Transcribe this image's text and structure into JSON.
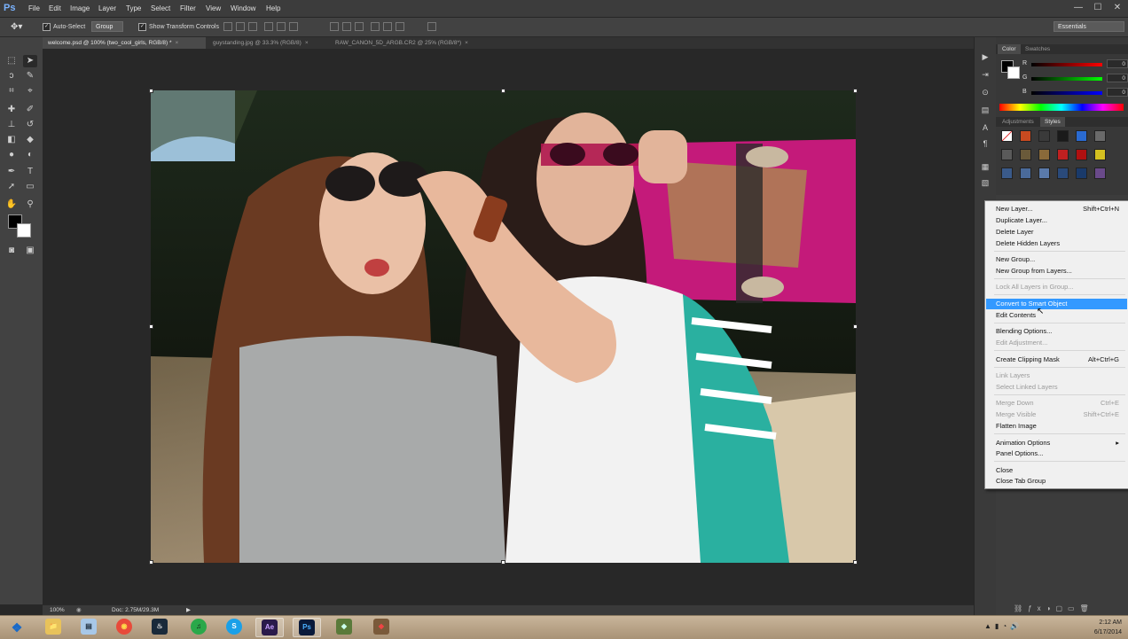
{
  "app": {
    "logo": "Ps"
  },
  "menubar": {
    "items": [
      "File",
      "Edit",
      "Image",
      "Layer",
      "Type",
      "Select",
      "Filter",
      "View",
      "Window",
      "Help"
    ],
    "win_min": "—",
    "win_max": "☐",
    "win_close": "✕"
  },
  "options": {
    "auto_select_label": "Auto-Select",
    "auto_select_value": "Group",
    "show_transform_label": "Show Transform Controls",
    "workspace": "Essentials"
  },
  "doc_tabs": [
    {
      "label": "welcome.psd @ 100% (two_cool_girls, RGB/8) *"
    },
    {
      "label": "guystanding.jpg @ 33.3% (RGB/8)"
    },
    {
      "label": "RAW_CANON_5D_ARGB.CR2 @ 25% (RGB/8*)"
    }
  ],
  "status": {
    "zoom": "100%",
    "doc": "Doc: 2.75M/29.3M"
  },
  "panels": {
    "color_tabs": [
      "Color",
      "Swatches"
    ],
    "sliders": [
      {
        "label": "R",
        "value": "0",
        "track_color": "linear-gradient(90deg,#000,#f00)"
      },
      {
        "label": "G",
        "value": "0",
        "track_color": "linear-gradient(90deg,#000,#0f0)"
      },
      {
        "label": "B",
        "value": "0",
        "track_color": "linear-gradient(90deg,#000,#00f)"
      }
    ],
    "style_tabs": [
      "Adjustments",
      "Styles"
    ]
  },
  "context_menu": {
    "items": [
      {
        "label": "New Layer...",
        "shortcut": "Shift+Ctrl+N",
        "state": "normal"
      },
      {
        "label": "Duplicate Layer...",
        "shortcut": "",
        "state": "normal"
      },
      {
        "label": "Delete Layer",
        "shortcut": "",
        "state": "normal"
      },
      {
        "label": "Delete Hidden Layers",
        "shortcut": "",
        "state": "normal"
      },
      {
        "label": "New Group...",
        "shortcut": "",
        "state": "normal"
      },
      {
        "label": "New Group from Layers...",
        "shortcut": "",
        "state": "normal"
      },
      {
        "label": "Lock All Layers in Group...",
        "shortcut": "",
        "state": "disabled"
      },
      {
        "label": "Convert to Smart Object",
        "shortcut": "",
        "state": "highlighted"
      },
      {
        "label": "Edit Contents",
        "shortcut": "",
        "state": "normal"
      },
      {
        "label": "Blending Options...",
        "shortcut": "",
        "state": "normal"
      },
      {
        "label": "Edit Adjustment...",
        "shortcut": "",
        "state": "disabled"
      },
      {
        "label": "Create Clipping Mask",
        "shortcut": "Alt+Ctrl+G",
        "state": "normal"
      },
      {
        "label": "Link Layers",
        "shortcut": "",
        "state": "disabled"
      },
      {
        "label": "Select Linked Layers",
        "shortcut": "",
        "state": "disabled"
      },
      {
        "label": "Merge Down",
        "shortcut": "Ctrl+E",
        "state": "disabled"
      },
      {
        "label": "Merge Visible",
        "shortcut": "Shift+Ctrl+E",
        "state": "disabled"
      },
      {
        "label": "Flatten Image",
        "shortcut": "",
        "state": "normal"
      },
      {
        "label": "Animation Options",
        "shortcut": "▸",
        "state": "normal"
      },
      {
        "label": "Panel Options...",
        "shortcut": "",
        "state": "normal"
      },
      {
        "label": "Close",
        "shortcut": "",
        "state": "normal"
      },
      {
        "label": "Close Tab Group",
        "shortcut": "",
        "state": "normal"
      }
    ]
  },
  "taskbar": {
    "time": "2:12 AM",
    "date": "6/17/2014",
    "apps": [
      {
        "name": "explorer-icon",
        "label": "📁"
      },
      {
        "name": "notepad-icon",
        "label": "▤"
      },
      {
        "name": "chrome-icon",
        "label": "◉"
      },
      {
        "name": "steam-icon",
        "label": "♨"
      },
      {
        "name": "spotify-icon",
        "label": "♫"
      },
      {
        "name": "skype-icon",
        "label": "S"
      },
      {
        "name": "after-effects-icon",
        "label": "Ae"
      },
      {
        "name": "photoshop-icon",
        "label": "Ps"
      },
      {
        "name": "app-icon-green",
        "label": "◆"
      },
      {
        "name": "app-icon-red",
        "label": "◆"
      }
    ]
  }
}
